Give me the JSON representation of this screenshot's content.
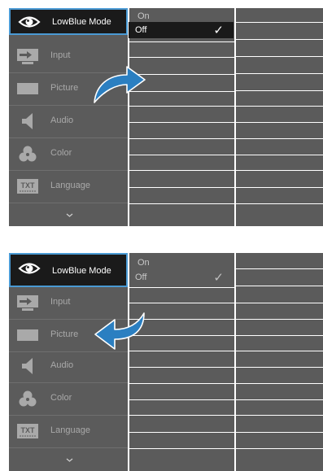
{
  "menu": {
    "items": [
      {
        "label": "LowBlue Mode",
        "icon": "eye-icon"
      },
      {
        "label": "Input",
        "icon": "input-icon"
      },
      {
        "label": "Picture",
        "icon": "picture-icon"
      },
      {
        "label": "Audio",
        "icon": "speaker-icon"
      },
      {
        "label": "Color",
        "icon": "color-icon"
      },
      {
        "label": "Language",
        "icon": "language-icon"
      }
    ],
    "language_icon_text": "TXT",
    "more_icon": "chevron-down-icon"
  },
  "submenu": {
    "on_label": "On",
    "off_label": "Off",
    "check_glyph": "✓"
  },
  "panels": [
    {
      "arrow": "curved-arrow-right-icon",
      "off_state": "active"
    },
    {
      "arrow": "curved-arrow-left-icon",
      "off_state": "inactive"
    }
  ],
  "colors": {
    "panel": "#5b5b5b",
    "selected": "#1a1a1a",
    "highlight_border": "#4a9ad4",
    "arrow": "#2b7fc1"
  }
}
